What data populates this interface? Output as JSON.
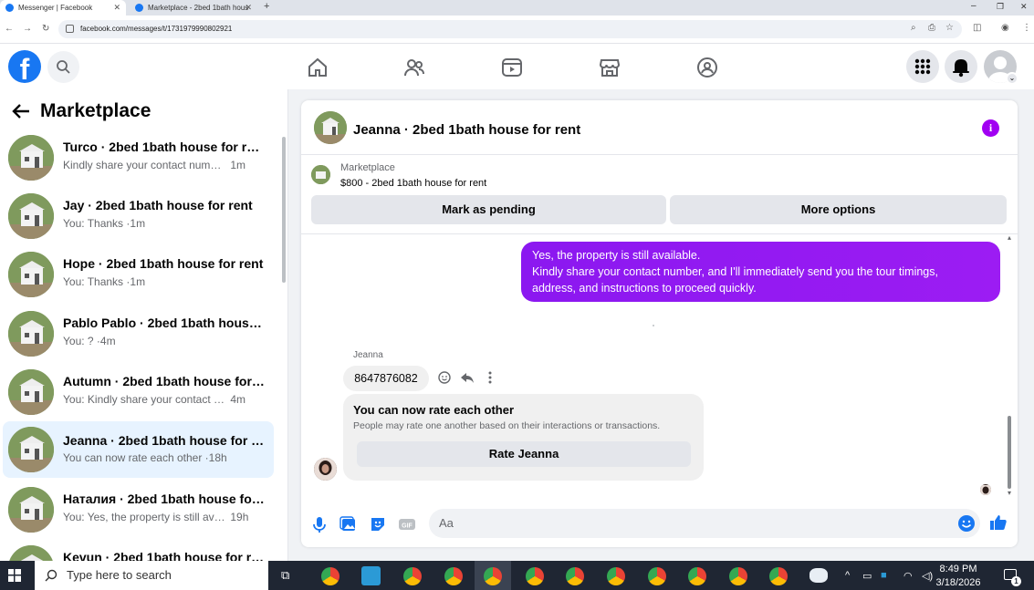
{
  "browser": {
    "tabs": [
      {
        "title": "Messenger | Facebook",
        "active": true
      },
      {
        "title": "Marketplace - 2bed 1bath hous",
        "active": false
      }
    ],
    "url": "facebook.com/messages/t/1731979990802921"
  },
  "sidebar": {
    "title": "Marketplace",
    "conversations": [
      {
        "title": "Turco · 2bed 1bath house for rent",
        "preview": "Kindly share your contact number ...",
        "time": "1m",
        "selected": false
      },
      {
        "title": "Jay · 2bed 1bath house for rent",
        "preview": "You: Thanks ·",
        "time": "1m",
        "selected": false
      },
      {
        "title": "Hope · 2bed 1bath house for rent",
        "preview": "You: Thanks ·",
        "time": "1m",
        "selected": false
      },
      {
        "title": "Pablo Pablo · 2bed 1bath house f...",
        "preview": "You: ? ·",
        "time": "4m",
        "selected": false
      },
      {
        "title": "Autumn · 2bed 1bath house for r...",
        "preview": "You: Kindly share your contact num...",
        "time": "4m",
        "selected": false
      },
      {
        "title": "Jeanna · 2bed 1bath house for rent",
        "preview": "You can now rate each other ·",
        "time": "18h",
        "selected": true
      },
      {
        "title": "Наталия · 2bed 1bath house for r...",
        "preview": "You: Yes, the property is still availab...",
        "time": "19h",
        "selected": false
      },
      {
        "title": "Kevun · 2bed 1bath house for rent",
        "preview": "",
        "time": "",
        "selected": false
      }
    ]
  },
  "chat": {
    "title": "Jeanna · 2bed 1bath house for rent",
    "marketplace_label": "Marketplace",
    "listing": "$800 - 2bed 1bath house for rent",
    "mark_pending_label": "Mark as pending",
    "more_options_label": "More options",
    "outgoing_message": {
      "line1": "Yes, the property is still available.",
      "line2": "Kindly share your contact number, and I'll immediately send you the tour timings,",
      "line3": "address, and instructions to proceed quickly."
    },
    "sender_name": "Jeanna",
    "incoming_message": "8647876082",
    "rating": {
      "title": "You can now rate each other",
      "subtitle": "People may rate one another based on their interactions or transactions.",
      "button": "Rate Jeanna"
    },
    "input_placeholder": "Aa"
  },
  "taskbar": {
    "search_placeholder": "Type here to search",
    "time": "8:49 PM",
    "date": "3/18/2026",
    "notification_count": "1"
  },
  "colors": {
    "brand": "#1877f2",
    "message_bubble": "#9318f2",
    "info_icon": "#a100f2",
    "selected_row": "#e7f3ff"
  }
}
